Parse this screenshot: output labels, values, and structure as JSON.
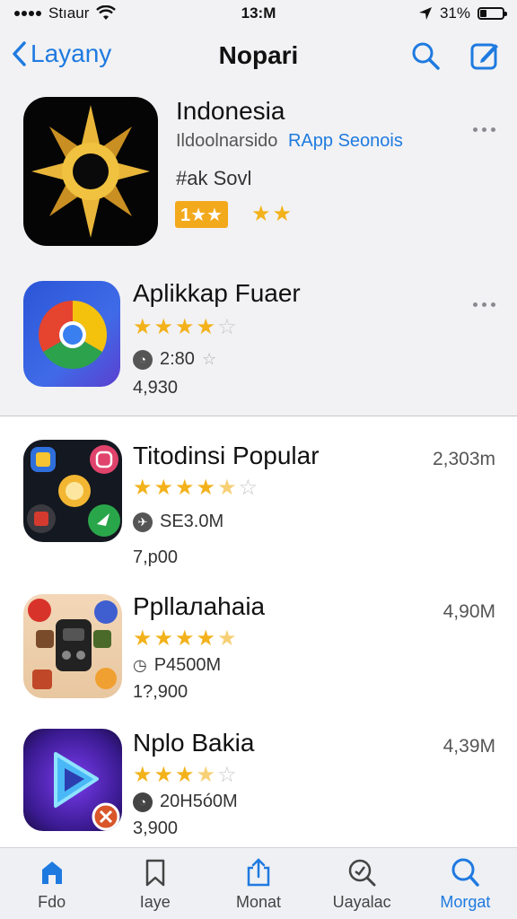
{
  "status": {
    "carrier": "Stıaur",
    "time": "13:M",
    "battery": "31%",
    "battery_level": 0.31
  },
  "nav": {
    "back_label": "Layany",
    "title": "Nopari"
  },
  "featured": [
    {
      "title": "Indonesia",
      "subtitle_gray": "Ildoolnarsido",
      "subtitle_blue": "RApp Seonois",
      "tag": "#ak Sovl",
      "rating_box": "1★★",
      "rating": 4.5,
      "icon": "golden-sun-icon"
    },
    {
      "title": "Aplikkap Fuaer",
      "rating": 4,
      "meta": "2:80",
      "count": "4,930",
      "icon": "chrome-logo-icon"
    }
  ],
  "list": [
    {
      "title": "Titodinsi  Popular",
      "rating": 4.5,
      "meta": "SE3.0M",
      "count": "7,p00",
      "size": "2,303m",
      "icon": "app-collage-icon"
    },
    {
      "title": "Ppllaлahaia",
      "rating": 4.5,
      "meta": "P4500M",
      "count": "1?,900",
      "size": "4,90M",
      "icon": "game-character-icon"
    },
    {
      "title": "Nplo Bakia",
      "rating": 3.5,
      "meta": "20H5ó0M",
      "count": "3,900",
      "size": "4,39M",
      "icon": "play-video-icon"
    }
  ],
  "tabs": [
    {
      "label": "Fdo",
      "icon": "home-icon"
    },
    {
      "label": "Iaye",
      "icon": "bookmark-icon"
    },
    {
      "label": "Monat",
      "icon": "share-icon"
    },
    {
      "label": "Uayalac",
      "icon": "search-magnify-icon"
    },
    {
      "label": "Morgat",
      "icon": "search-icon",
      "active": true
    }
  ],
  "colors": {
    "accent": "#1f7ae0",
    "star": "#f3b21b",
    "rating_box": "#f3a91c"
  }
}
